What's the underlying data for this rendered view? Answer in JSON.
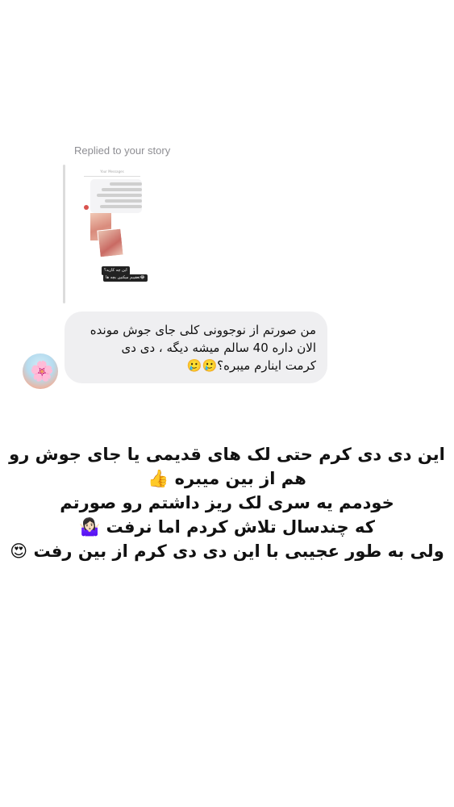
{
  "reply": {
    "label": "Replied to your story",
    "story": {
      "header": "Your Messages",
      "caption_line1": "این چه کاریه؟",
      "caption_line2": "تعقیبم میکنین بچه ها😂"
    }
  },
  "message": {
    "lines": [
      "من صورتم از نوجوونی کلی جای جوش مونده",
      "الان داره 40 سالم میشه دیگه ، دی دی",
      "کرمت اینارم میبره؟🥲🥲"
    ],
    "avatar_icon": "flower-avatar-icon"
  },
  "caption": {
    "lines": [
      "این دی دی کرم حتی لک های قدیمی یا جای جوش رو",
      "هم از بین میبره 👍",
      "خودمم یه سری لک ریز داشتم رو صورتم",
      "که چندسال تلاش کردم اما نرفت 🤷🏻‍♀️",
      "ولی به طور عجیبی با این دی دی کرم از بین رفت 😍"
    ]
  }
}
